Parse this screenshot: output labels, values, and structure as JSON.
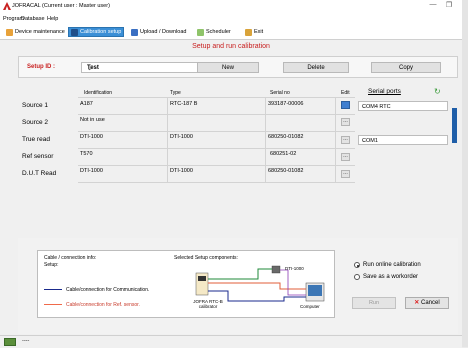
{
  "window": {
    "title": "JOFRACAL (Current user : Master user)",
    "minimize": "—",
    "restore": "❐"
  },
  "menubar": {
    "items": [
      "Program",
      "Database",
      "Help"
    ]
  },
  "toolbar": {
    "items": [
      "Device maintenance",
      "Calibration setup",
      "Upload / Download",
      "Scheduler",
      "Exit"
    ],
    "active_index": 1
  },
  "heading": "Setup and run calibration",
  "setup": {
    "label": "Setup ID :",
    "value": "Test",
    "new_label": "New",
    "delete_label": "Delete",
    "copy_label": "Copy"
  },
  "grid": {
    "columns": [
      "Identification",
      "Type",
      "Serial no",
      "Edit"
    ],
    "serial_ports_label": "Serial ports",
    "rows": [
      {
        "label": "Source 1",
        "identification": "A187",
        "type": "RTC-187 B",
        "serial": "393187-00006",
        "port": "COM4 RTC"
      },
      {
        "label": "Source 2",
        "identification": "Not in use",
        "type": "",
        "serial": "",
        "port": ""
      },
      {
        "label": "True read",
        "identification": "DTI-1000",
        "type": "DTI-1000",
        "serial": "680250-01082",
        "port": "COM1"
      },
      {
        "label": "Ref sensor",
        "identification": "T570",
        "type": "",
        "serial": "680251-02",
        "port": ""
      },
      {
        "label": "D.U.T Read",
        "identification": "DTI-1000",
        "type": "DTI-1000",
        "serial": "680250-01082",
        "port": ""
      }
    ]
  },
  "info": {
    "title": "Cable / connection info:",
    "setup_label": "Setup:",
    "components_label": "Selected Setup components:",
    "comm_label": "Cable/connection for Communication.",
    "ref_label": "Cable/connection for Ref. sensor.",
    "device_label": "DTI-1000",
    "computer_label": "Computer",
    "calibrator_label": "JOFRA RTC-B calibrator",
    "comm_color": "#1a2a8c",
    "ref_color": "#f06a4a"
  },
  "options": {
    "online_label": "Run online calibration",
    "workorder_label": "Save as a workorder",
    "selected": "online"
  },
  "actions": {
    "run_label": "Run",
    "cancel_label": "Cancel"
  },
  "status": {
    "text": "----"
  }
}
